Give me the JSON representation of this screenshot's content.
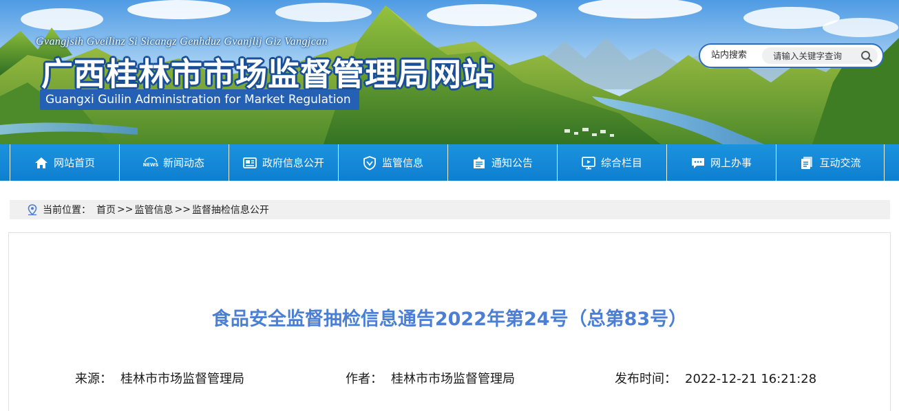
{
  "header": {
    "pinyin": "Gvangjsih Gveilinz Si Sicangz Genhduz Gvanjlij Giz Vangjcan",
    "title": "广西桂林市市场监督管理局网站",
    "english": "Guangxi Guilin Administration for Market Regulation"
  },
  "search": {
    "label": "站内搜索",
    "placeholder": "请输入关键字查询"
  },
  "nav": {
    "items": [
      {
        "label": "网站首页",
        "icon": "home-icon"
      },
      {
        "label": "新闻动态",
        "icon": "news-icon"
      },
      {
        "label": "政府信息公开",
        "icon": "newspaper-icon"
      },
      {
        "label": "监管信息",
        "icon": "shield-icon"
      },
      {
        "label": "通知公告",
        "icon": "notice-icon"
      },
      {
        "label": "综合栏目",
        "icon": "monitor-icon"
      },
      {
        "label": "网上办事",
        "icon": "chat-icon"
      },
      {
        "label": "互动交流",
        "icon": "document-icon"
      }
    ]
  },
  "breadcrumb": {
    "label": "当前位置：",
    "items": [
      "首页",
      "监管信息",
      "监督抽检信息公开"
    ],
    "separator": ">>"
  },
  "article": {
    "title": "食品安全监督抽检信息通告2022年第24号（总第83号）",
    "source_label": "来源：",
    "source": "桂林市市场监督管理局",
    "author_label": "作者：",
    "author": "桂林市市场监督管理局",
    "date_label": "发布时间：",
    "date": "2022-12-21 16:21:28"
  },
  "colors": {
    "nav_blue": "#1589d6",
    "title_blue": "#4a7fd4",
    "english_band": "#2460b4"
  }
}
